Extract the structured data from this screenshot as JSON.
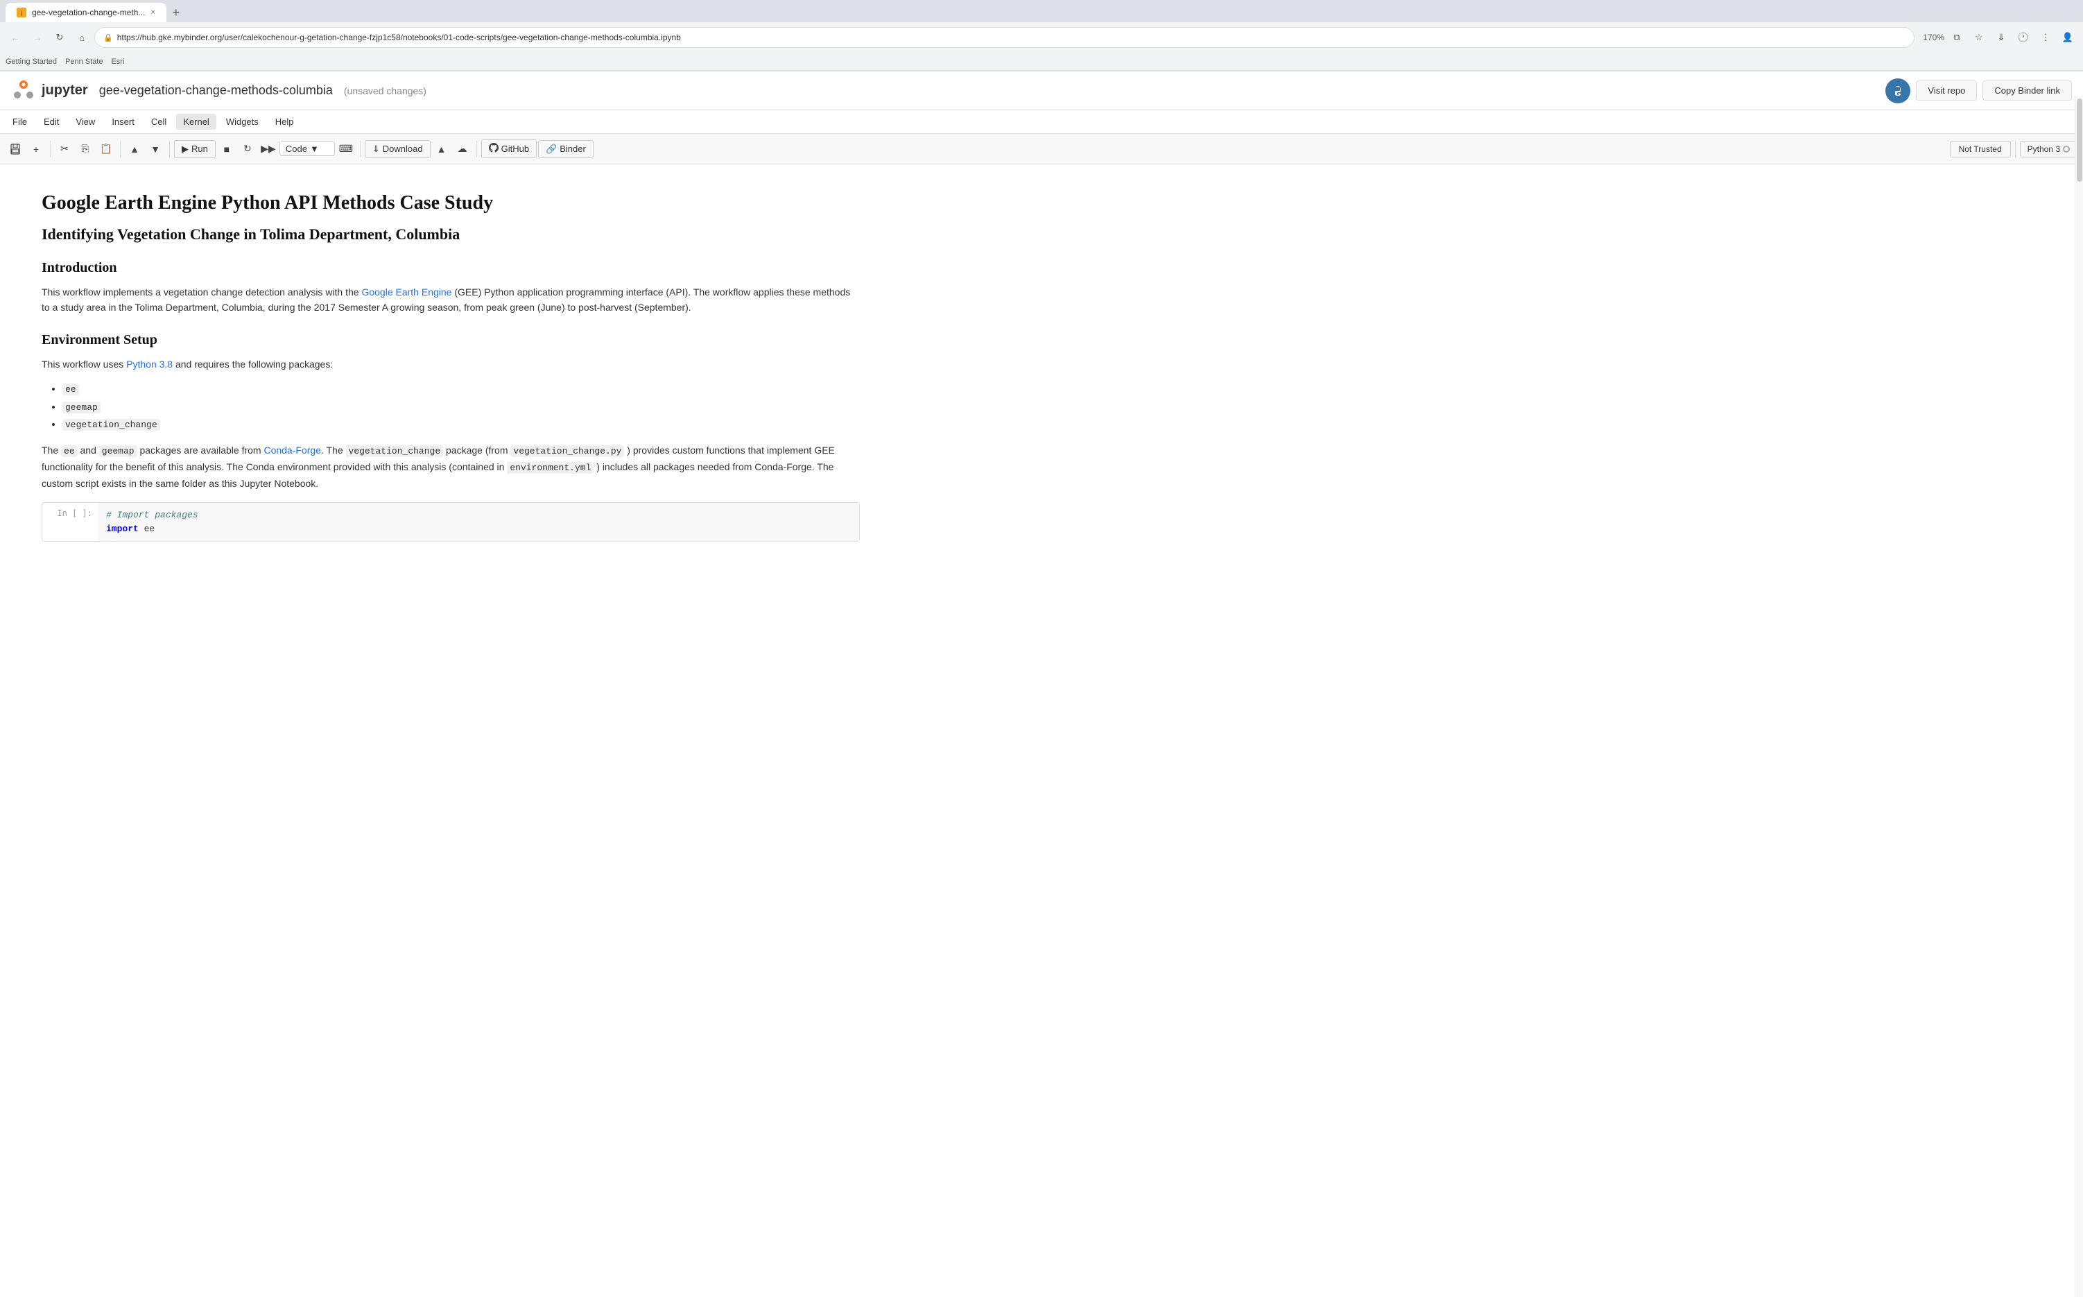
{
  "browser": {
    "tab_title": "gee-vegetation-change-meth...",
    "tab_new_label": "+",
    "tab_close": "×",
    "nav": {
      "back_disabled": true,
      "forward_disabled": true,
      "reload": "⟳",
      "home": "⌂",
      "url": "https://hub.gke.mybinder.org/user/calekochenour-g-getation-change-fzjp1c58/notebooks/01-code-scripts/gee-vegetation-change-methods-columbia.ipynb",
      "zoom": "170%"
    },
    "bookmarks": [
      "Getting Started",
      "Penn State",
      "Esri"
    ]
  },
  "header": {
    "logo_text": "jupyter",
    "notebook_filename": "gee-vegetation-change-methods-columbia",
    "unsaved": "(unsaved changes)",
    "visit_repo_label": "Visit repo",
    "copy_binder_label": "Copy Binder link"
  },
  "menubar": {
    "items": [
      "File",
      "Edit",
      "View",
      "Insert",
      "Cell",
      "Kernel",
      "Widgets",
      "Help"
    ]
  },
  "toolbar": {
    "run_label": "Run",
    "cell_type": "Code",
    "download_label": "Download",
    "github_label": "GitHub",
    "binder_label": "Binder",
    "not_trusted_label": "Not Trusted",
    "kernel_label": "Python 3"
  },
  "content": {
    "title": "Google Earth Engine Python API Methods Case Study",
    "subtitle": "Identifying Vegetation Change in Tolima Department, Columbia",
    "intro_heading": "Introduction",
    "intro_p1": "This workflow implements a vegetation change detection analysis with the Google Earth Engine (GEE) Python application programming interface (API). The workflow applies these methods to a study area in the Tolima Department, Columbia, during the 2017 Semester A growing season, from peak green (June) to post-harvest (September).",
    "intro_link_text": "Google Earth Engine",
    "setup_heading": "Environment Setup",
    "setup_p1": "This workflow uses Python 3.8 and requires the following packages:",
    "setup_link_text": "Python 3.8",
    "packages": [
      "ee",
      "geemap",
      "vegetation_change"
    ],
    "setup_p2_pre": "The ",
    "setup_p2_ee": "ee",
    "setup_p2_and": " and ",
    "setup_p2_geemap": "geemap",
    "setup_p2_mid": " packages are available from ",
    "setup_p2_condaforge_link": "Conda-Forge",
    "setup_p2_post": ". The ",
    "setup_p2_vegchange": "vegetation_change",
    "setup_p2_cont": " package (from ",
    "setup_p2_script": "vegetation_change.py",
    "setup_p2_end": " ) provides custom functions that implement GEE functionality for the benefit of this analysis. The Conda environment provided with this analysis (contained in ",
    "setup_p2_yml": "environment.yml",
    "setup_p2_final": " ) includes all packages needed from Conda-Forge. The custom script exists in the same folder as this Jupyter Notebook.",
    "code_cell_label": "In [ ]:",
    "code_comment": "# Import packages",
    "code_import": "import ee"
  }
}
